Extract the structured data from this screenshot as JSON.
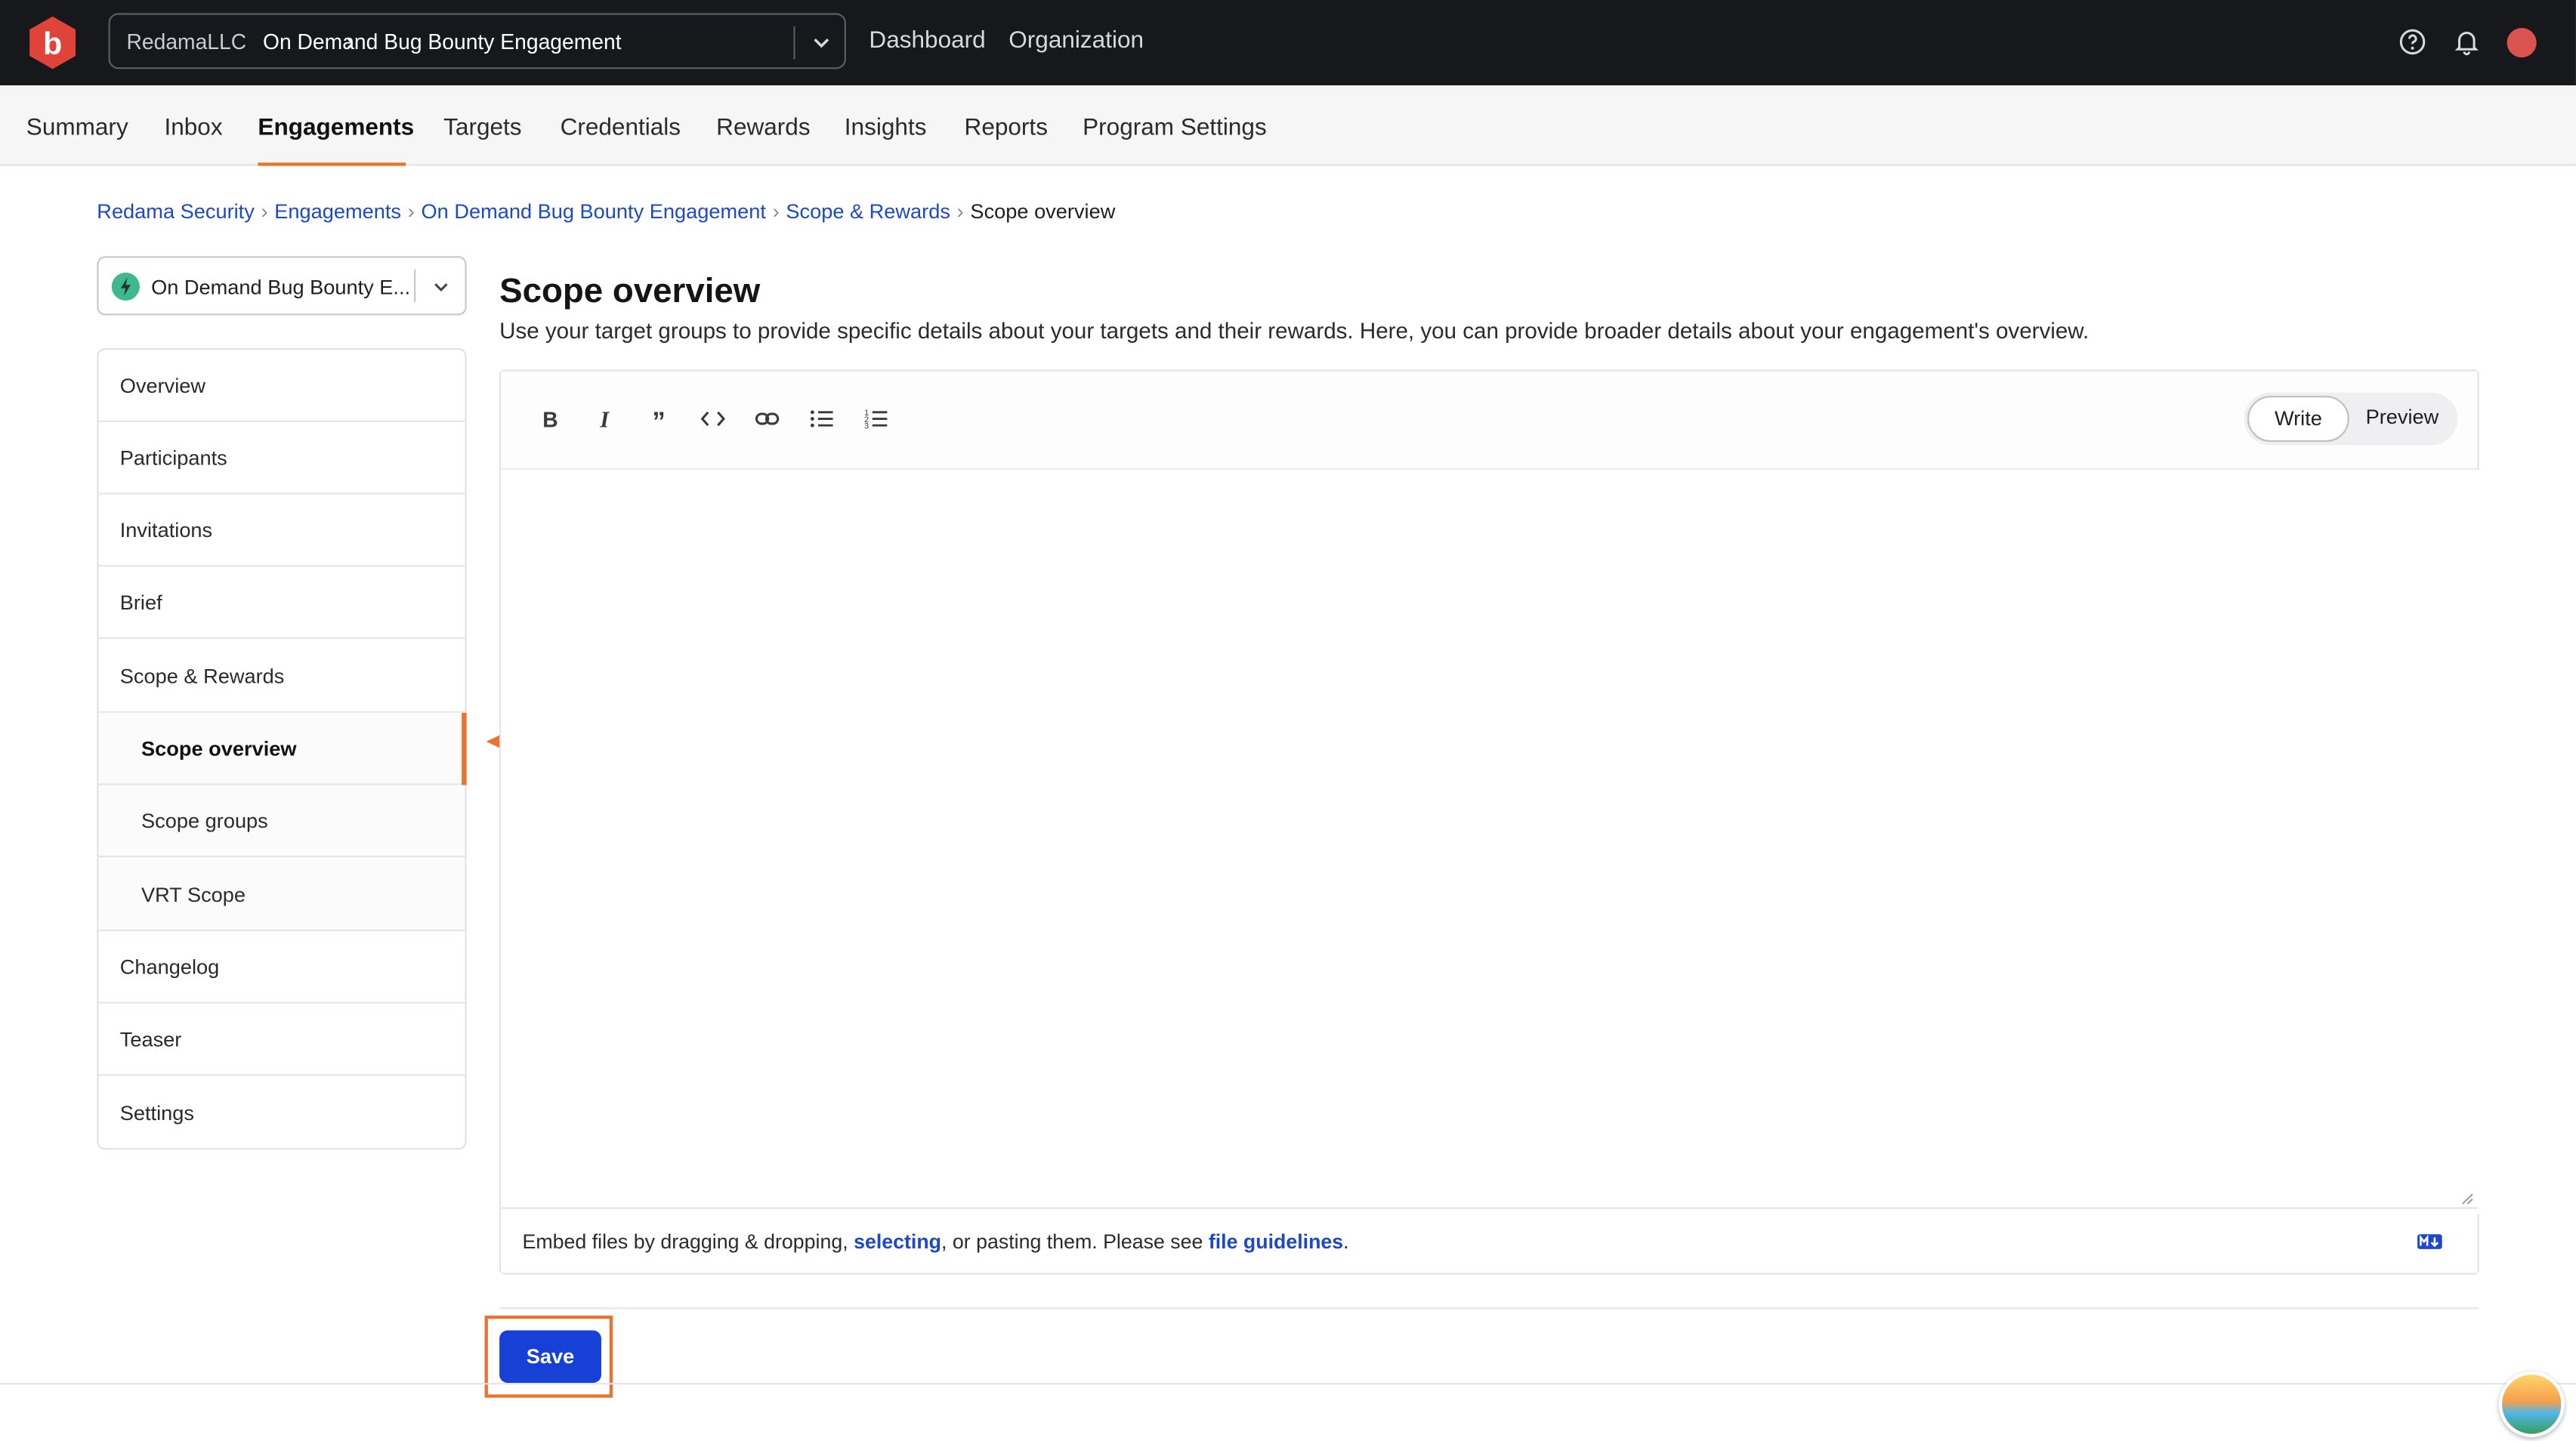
{
  "topbar": {
    "org": "RedamaLLC",
    "engagement": "On Demand Bug Bounty Engagement",
    "links": [
      "Dashboard",
      "Organization"
    ]
  },
  "tabs": [
    "Summary",
    "Inbox",
    "Engagements",
    "Targets",
    "Credentials",
    "Rewards",
    "Insights",
    "Reports",
    "Program Settings"
  ],
  "active_tab": "Engagements",
  "breadcrumb": [
    "Redama Security",
    "Engagements",
    "On Demand Bug Bounty Engagement",
    "Scope & Rewards",
    "Scope overview"
  ],
  "engagement_selector": "On Demand Bug Bounty E...",
  "sidenav": [
    {
      "label": "Overview",
      "level": 1
    },
    {
      "label": "Participants",
      "level": 1
    },
    {
      "label": "Invitations",
      "level": 1
    },
    {
      "label": "Brief",
      "level": 1
    },
    {
      "label": "Scope & Rewards",
      "level": 1
    },
    {
      "label": "Scope overview",
      "level": 2,
      "active": true
    },
    {
      "label": "Scope groups",
      "level": 2
    },
    {
      "label": "VRT Scope",
      "level": 2
    },
    {
      "label": "Changelog",
      "level": 1
    },
    {
      "label": "Teaser",
      "level": 1
    },
    {
      "label": "Settings",
      "level": 1
    }
  ],
  "main": {
    "title": "Scope overview",
    "description": "Use your target groups to provide specific details about your targets and their rewards. Here, you can provide broader details about your engagement's overview.",
    "editor": {
      "mode_write": "Write",
      "mode_preview": "Preview",
      "value": "",
      "footer_prefix": "Embed files by dragging & dropping, ",
      "footer_link1": "selecting",
      "footer_middle": ", or pasting them. Please see ",
      "footer_link2": "file guidelines",
      "footer_suffix": "."
    },
    "save_label": "Save"
  },
  "colors": {
    "topbar": "#17181c",
    "accent": "#e8742f",
    "link": "#1b49c9",
    "primary_button": "#1740d6",
    "brand": "#e0433a"
  }
}
